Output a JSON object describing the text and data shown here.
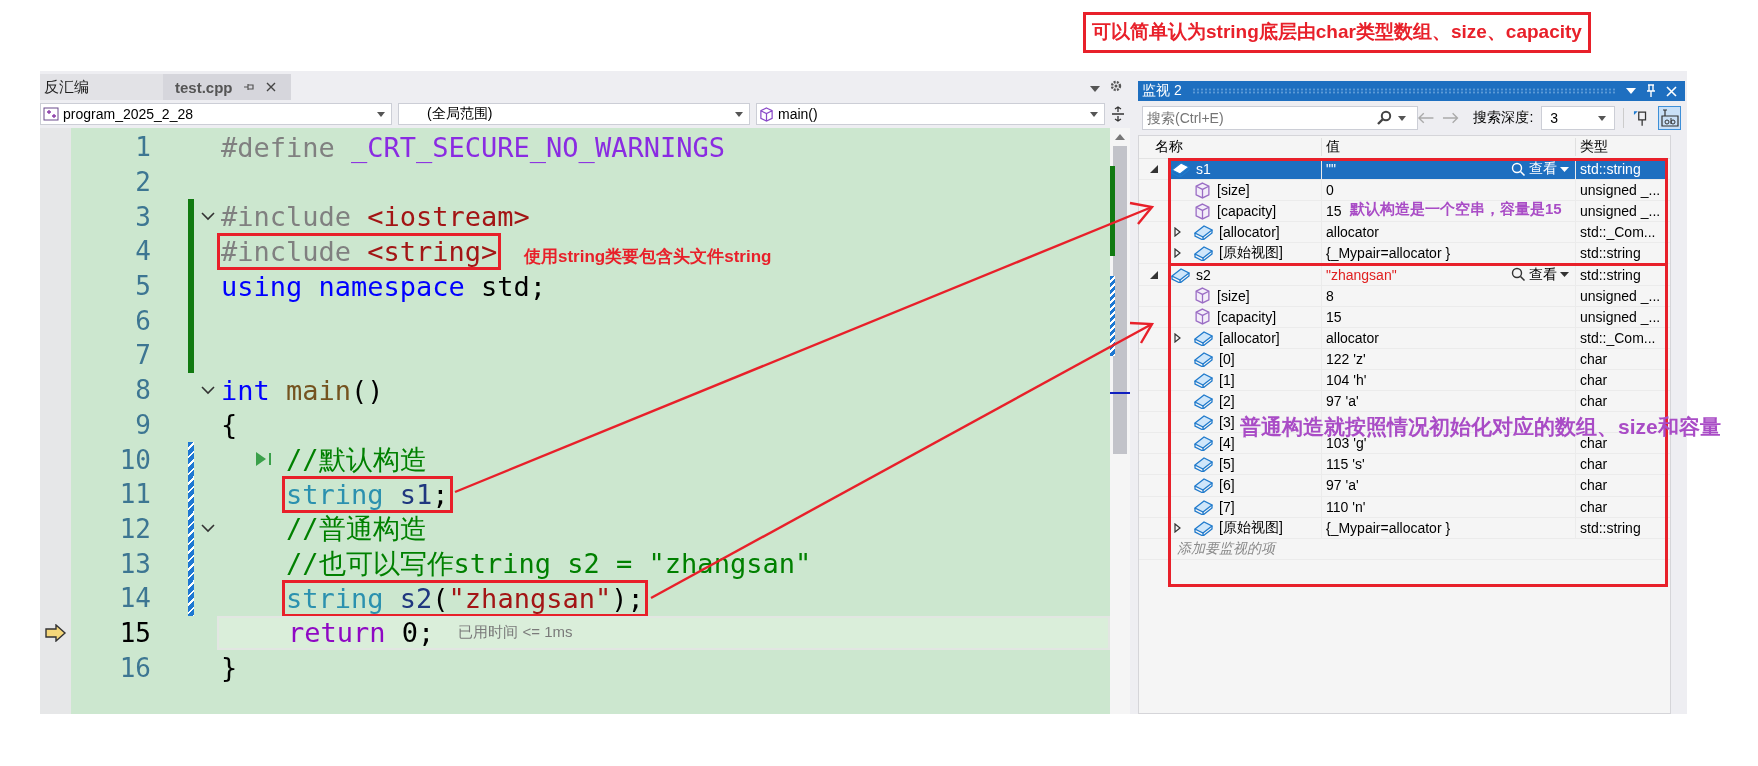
{
  "editor": {
    "tabs": [
      {
        "label": "反汇编",
        "selected": false,
        "closable": false
      },
      {
        "label": "test.cpp",
        "selected": true,
        "closable": true
      }
    ],
    "project_dropdown": "program_2025_2_28",
    "scope_dropdown": "(全局范围)",
    "member_dropdown": "main()",
    "lines": [
      {
        "number": "1",
        "modified": false,
        "fold": false,
        "current": false,
        "boxed": false,
        "tokens": [
          {
            "t": "#define ",
            "color": "#808080"
          },
          {
            "t": "_CRT_SECURE_NO_WARNINGS",
            "color": "#8a2be2"
          }
        ]
      },
      {
        "number": "2",
        "modified": false,
        "fold": false,
        "current": false
      },
      {
        "number": "3",
        "modified": true,
        "saved": true,
        "fold": true,
        "current": false,
        "boxed": false,
        "tokens": [
          {
            "t": "#include ",
            "color": "#808080"
          },
          {
            "t": "<iostream>",
            "color": "#a31515"
          }
        ]
      },
      {
        "number": "4",
        "modified": true,
        "saved": true,
        "fold": false,
        "current": false,
        "boxed": true,
        "tokens": [
          {
            "t": "#include ",
            "color": "#808080"
          },
          {
            "t": "<string>",
            "color": "#a31515"
          }
        ]
      },
      {
        "number": "5",
        "modified": true,
        "saved": true,
        "fold": false,
        "current": false,
        "boxed": false,
        "tokens": [
          {
            "t": "using namespace ",
            "color": "#0000ff"
          },
          {
            "t": "std;",
            "color": "#000000"
          }
        ]
      },
      {
        "number": "6",
        "modified": true,
        "saved": true,
        "fold": false,
        "current": false
      },
      {
        "number": "7",
        "modified": true,
        "saved": true,
        "fold": false,
        "current": false
      },
      {
        "number": "8",
        "modified": false,
        "fold": true,
        "current": false,
        "boxed": false,
        "tokens": [
          {
            "t": "int ",
            "color": "#0000ff"
          },
          {
            "t": "main",
            "color": "#74531f"
          },
          {
            "t": "()",
            "color": "#000000"
          }
        ]
      },
      {
        "number": "9",
        "modified": false,
        "fold": false,
        "current": false,
        "boxed": false,
        "tokens": [
          {
            "t": "{",
            "color": "#000000"
          }
        ]
      },
      {
        "number": "10",
        "modified": true,
        "saved": false,
        "fold": false,
        "current": false,
        "boxed": false,
        "run_glyph": true,
        "tokens": [
          {
            "t": "    //默认构造",
            "color": "#008000"
          }
        ]
      },
      {
        "number": "11",
        "modified": true,
        "saved": false,
        "fold": false,
        "current": false,
        "boxed": true,
        "tokens": [
          {
            "t": "    string ",
            "color": "#2b91af"
          },
          {
            "t": "s1",
            "color": "#1f377f"
          },
          {
            "t": ";",
            "color": "#000000"
          }
        ]
      },
      {
        "number": "12",
        "modified": true,
        "saved": false,
        "fold": true,
        "current": false,
        "boxed": false,
        "tokens": [
          {
            "t": "    //普通构造",
            "color": "#008000"
          }
        ]
      },
      {
        "number": "13",
        "modified": true,
        "saved": false,
        "fold": false,
        "current": false,
        "boxed": false,
        "tokens": [
          {
            "t": "    //也可以写作string s2 = \"zhangsan\"",
            "color": "#008000"
          }
        ]
      },
      {
        "number": "14",
        "modified": true,
        "saved": false,
        "fold": false,
        "current": false,
        "boxed": true,
        "tokens": [
          {
            "t": "    string ",
            "color": "#2b91af"
          },
          {
            "t": "s2",
            "color": "#1f377f"
          },
          {
            "t": "(",
            "color": "#000000"
          },
          {
            "t": "\"zhangsan\"",
            "color": "#a31515"
          },
          {
            "t": ");",
            "color": "#000000"
          }
        ]
      },
      {
        "number": "15",
        "modified": false,
        "fold": false,
        "current": true,
        "boxed": false,
        "hint": "已用时间 <= 1ms",
        "tokens": [
          {
            "t": "    return ",
            "color": "#8f08c4"
          },
          {
            "t": "0;",
            "color": "#000000"
          }
        ]
      },
      {
        "number": "16",
        "modified": false,
        "fold": false,
        "current": false,
        "boxed": false,
        "tokens": [
          {
            "t": "}",
            "color": "#000000"
          }
        ]
      }
    ]
  },
  "watch": {
    "title": "监视 2",
    "search_placeholder": "搜索(Ctrl+E)",
    "depth_label": "搜索深度:",
    "depth_value": "3",
    "columns": [
      "名称",
      "值",
      "类型"
    ],
    "rows": [
      {
        "name": "s1",
        "value": "\"\"",
        "type": "std::string",
        "kind": "object",
        "expanded": true,
        "selected": true,
        "changed": false,
        "visualizer": "查看",
        "boxed": true,
        "children": [
          {
            "name": "[size]",
            "value": "0",
            "type": "unsigned _...",
            "kind": "field",
            "selected": false,
            "changed": false
          },
          {
            "name": "[capacity]",
            "value": "15",
            "type": "unsigned _...",
            "kind": "field",
            "selected": false,
            "changed": false
          },
          {
            "name": "[allocator]",
            "value": "allocator",
            "type": "std::_Com...",
            "kind": "object",
            "expanded": false,
            "selected": false,
            "changed": false
          },
          {
            "name": "[原始视图]",
            "value": "{_Mypair=allocator }",
            "type": "std::string",
            "kind": "object",
            "expanded": false,
            "selected": false,
            "changed": false
          }
        ]
      },
      {
        "name": "s2",
        "value": "\"zhangsan\"",
        "type": "std::string",
        "kind": "object",
        "expanded": true,
        "selected": false,
        "changed": true,
        "visualizer": "查看",
        "boxed": true,
        "children": [
          {
            "name": "[size]",
            "value": "8",
            "type": "unsigned _...",
            "kind": "field",
            "selected": false,
            "changed": false
          },
          {
            "name": "[capacity]",
            "value": "15",
            "type": "unsigned _...",
            "kind": "field",
            "selected": false,
            "changed": false
          },
          {
            "name": "[allocator]",
            "value": "allocator",
            "type": "std::_Com...",
            "kind": "object",
            "expanded": false,
            "selected": false,
            "changed": false
          },
          {
            "name": "[0]",
            "value": "122 'z'",
            "type": "char",
            "kind": "object",
            "selected": false,
            "changed": false
          },
          {
            "name": "[1]",
            "value": "104 'h'",
            "type": "char",
            "kind": "object",
            "selected": false,
            "changed": false
          },
          {
            "name": "[2]",
            "value": "97 'a'",
            "type": "char",
            "kind": "object",
            "selected": false,
            "changed": false
          },
          {
            "name": "[3]",
            "kind": "object",
            "selected": false
          },
          {
            "name": "[4]",
            "value": "103 'g'",
            "type": "char",
            "kind": "object",
            "selected": false,
            "changed": false
          },
          {
            "name": "[5]",
            "value": "115 's'",
            "type": "char",
            "kind": "object",
            "selected": false,
            "changed": false
          },
          {
            "name": "[6]",
            "value": "97 'a'",
            "type": "char",
            "kind": "object",
            "selected": false,
            "changed": false
          },
          {
            "name": "[7]",
            "value": "110 'n'",
            "type": "char",
            "kind": "object",
            "selected": false,
            "changed": false
          },
          {
            "name": "[原始视图]",
            "value": "{_Mypair=allocator }",
            "type": "std::string",
            "kind": "object",
            "expanded": false,
            "selected": false,
            "changed": false
          }
        ]
      }
    ],
    "add_placeholder": "添加要监视的项"
  },
  "notes": [
    {
      "text": "可以简单认为string底层由char类型数组、size、capacity",
      "color": "#e8202a",
      "boxed": true
    },
    {
      "text": "使用string类要包含头文件string",
      "color": "#e8202a",
      "boxed": false
    },
    {
      "text": "默认构造是一个空串，容量是15",
      "color": "#a94cc6",
      "boxed": false
    },
    {
      "text": "普通构造就按照情况初始化对应的数组、size和容量",
      "color": "#a94cc6",
      "boxed": false
    }
  ]
}
